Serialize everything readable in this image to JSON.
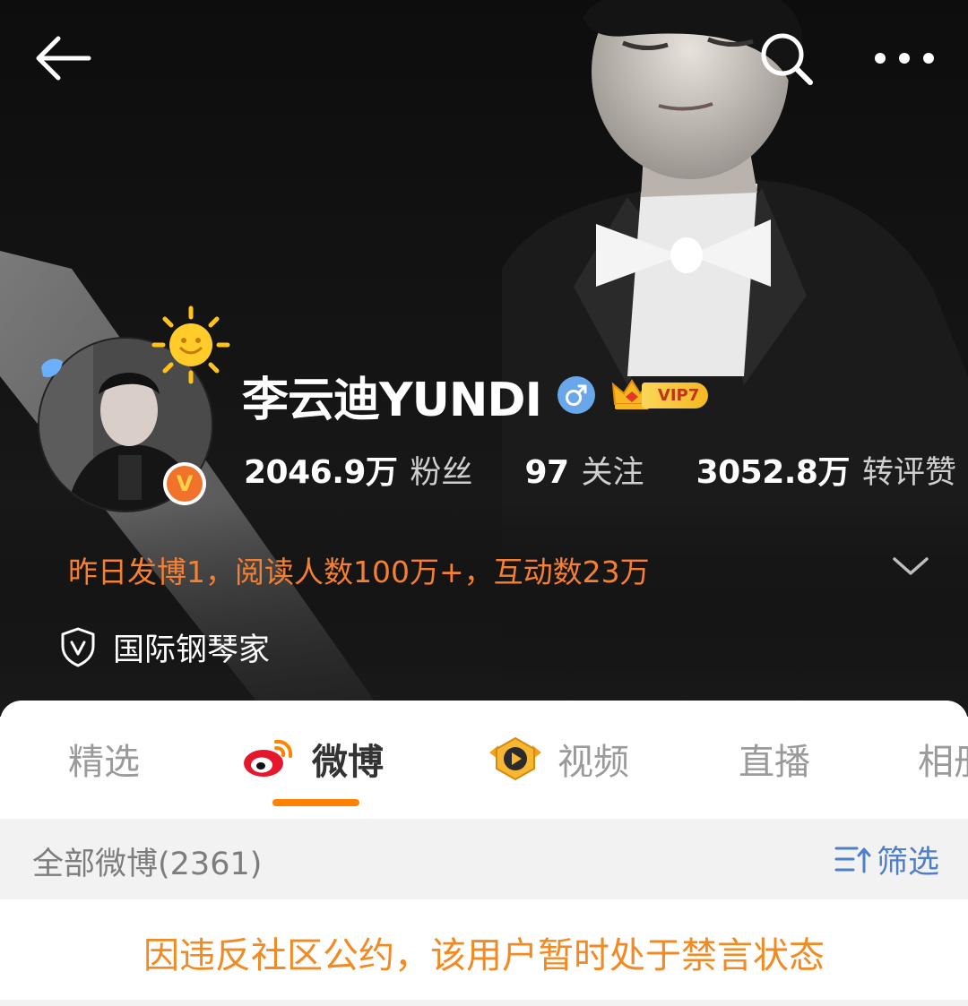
{
  "profile": {
    "name": "李云迪YUNDI",
    "vip_label": "VIP7",
    "v_badge": "V",
    "stats": [
      {
        "value": "2046.9万",
        "label": "粉丝"
      },
      {
        "value": "97",
        "label": "关注"
      },
      {
        "value": "3052.8万",
        "label": "转评赞"
      }
    ],
    "summary": "昨日发博1，阅读人数100万+，互动数23万",
    "certification": "国际钢琴家"
  },
  "tabs": [
    {
      "label": "精选",
      "active": false
    },
    {
      "label": "微博",
      "active": true
    },
    {
      "label": "视频",
      "active": false
    },
    {
      "label": "直播",
      "active": false
    },
    {
      "label": "相册",
      "active": false
    }
  ],
  "feed": {
    "count_label": "全部微博(2361)",
    "filter_label": "筛选"
  },
  "notice": "因违反社区公约，该用户暂时处于禁言状态",
  "colors": {
    "accent_orange": "#ff8200",
    "summary_orange": "#f57f32",
    "notice_orange": "#f28a24",
    "filter_blue": "#4f7fc9",
    "gender_blue": "#6aa7ea"
  },
  "icons": [
    "back-arrow-icon",
    "search-icon",
    "more-dots-icon",
    "sun-pendant-icon",
    "verified-v-icon",
    "male-gender-icon",
    "vip-crown-icon",
    "chevron-down-icon",
    "shield-v-icon",
    "weibo-logo-icon",
    "video-play-icon",
    "filter-icon"
  ]
}
